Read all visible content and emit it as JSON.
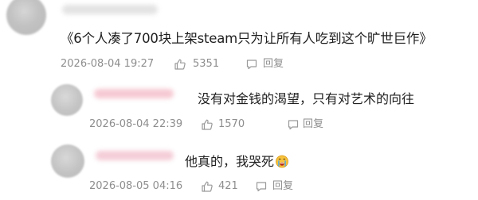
{
  "comments": [
    {
      "text": "《6个人凑了700块上架steam只为让所有人吃到这个旷世巨作》",
      "timestamp": "2026-08-04 19:27",
      "likes": "5351",
      "reply_label": "回复"
    },
    {
      "text": "没有对金钱的渴望，只有对艺术的向往",
      "timestamp": "2026-08-04 22:39",
      "likes": "1570",
      "reply_label": "回复"
    },
    {
      "text": "他真的，我哭死",
      "timestamp": "2026-08-05 04:16",
      "likes": "421",
      "reply_label": "回复"
    }
  ],
  "icons": {
    "like": "thumbs-up-icon",
    "reply": "speech-bubble-icon",
    "emoji": "crying-face-icon"
  },
  "colors": {
    "meta_text": "#8e8e8e",
    "body_text": "#1e1e1e",
    "icon_stroke": "#9a9a9a"
  }
}
